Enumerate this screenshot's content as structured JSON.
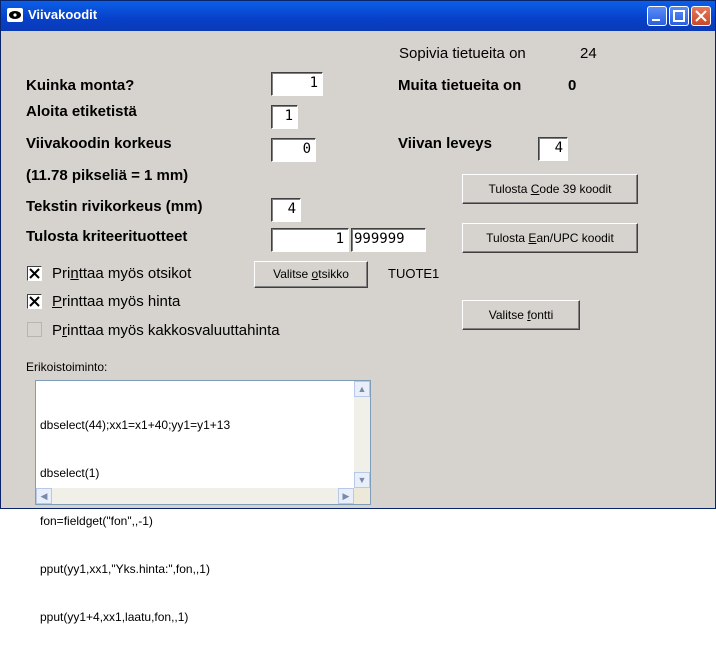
{
  "window": {
    "title": "Viivakoodit"
  },
  "stats": {
    "matching_label": "Sopivia tietueita on",
    "matching_value": "24",
    "other_label": "Muita tietueita on",
    "other_value": "0"
  },
  "form": {
    "count_label": "Kuinka monta?",
    "count_value": "1",
    "start_label": "Aloita etiketistä",
    "start_value": "1",
    "height_label": "Viivakoodin korkeus",
    "height_value": "0",
    "pixels_note": "(11.78 pikseliä = 1 mm)",
    "textrow_label": "Tekstin rivikorkeus (mm)",
    "textrow_value": "4",
    "criteria_label": "Tulosta kriteerituotteet",
    "criteria_from": "1",
    "criteria_to": "999999",
    "barwidth_label": "Viivan leveys",
    "barwidth_value": "4"
  },
  "buttons": {
    "code39": {
      "pre": "Tulosta ",
      "key": "C",
      "post": "ode 39 koodit"
    },
    "ean": {
      "pre": "Tulosta ",
      "key": "E",
      "post": "an/UPC koodit"
    },
    "select_title": {
      "pre": "Valitse ",
      "key": "o",
      "post": "tsikko"
    },
    "select_font": {
      "pre": "Valitse ",
      "key": "f",
      "post": "ontti"
    }
  },
  "options": {
    "print_titles": {
      "pre": "Pri",
      "key": "n",
      "post": "ttaa myös otsikot",
      "checked": true
    },
    "print_price": {
      "pre": "",
      "key": "P",
      "post": "rinttaa myös hinta",
      "checked": true
    },
    "print_second_currency": {
      "pre": "P",
      "key": "r",
      "post": "inttaa myös kakkosvaluuttahinta",
      "checked": false
    },
    "title_value": "TUOTE1"
  },
  "special": {
    "label": "Erikoistoiminto:",
    "code": [
      "dbselect(44);xx1=x1+40;yy1=y1+13",
      "dbselect(1)",
      "fon=fieldget(\"fon\",,-1)",
      "pput(yy1,xx1,\"Yks.hinta:\",fon,,1)",
      "pput(yy1+4,xx1,laatu,fon,,1)"
    ]
  }
}
